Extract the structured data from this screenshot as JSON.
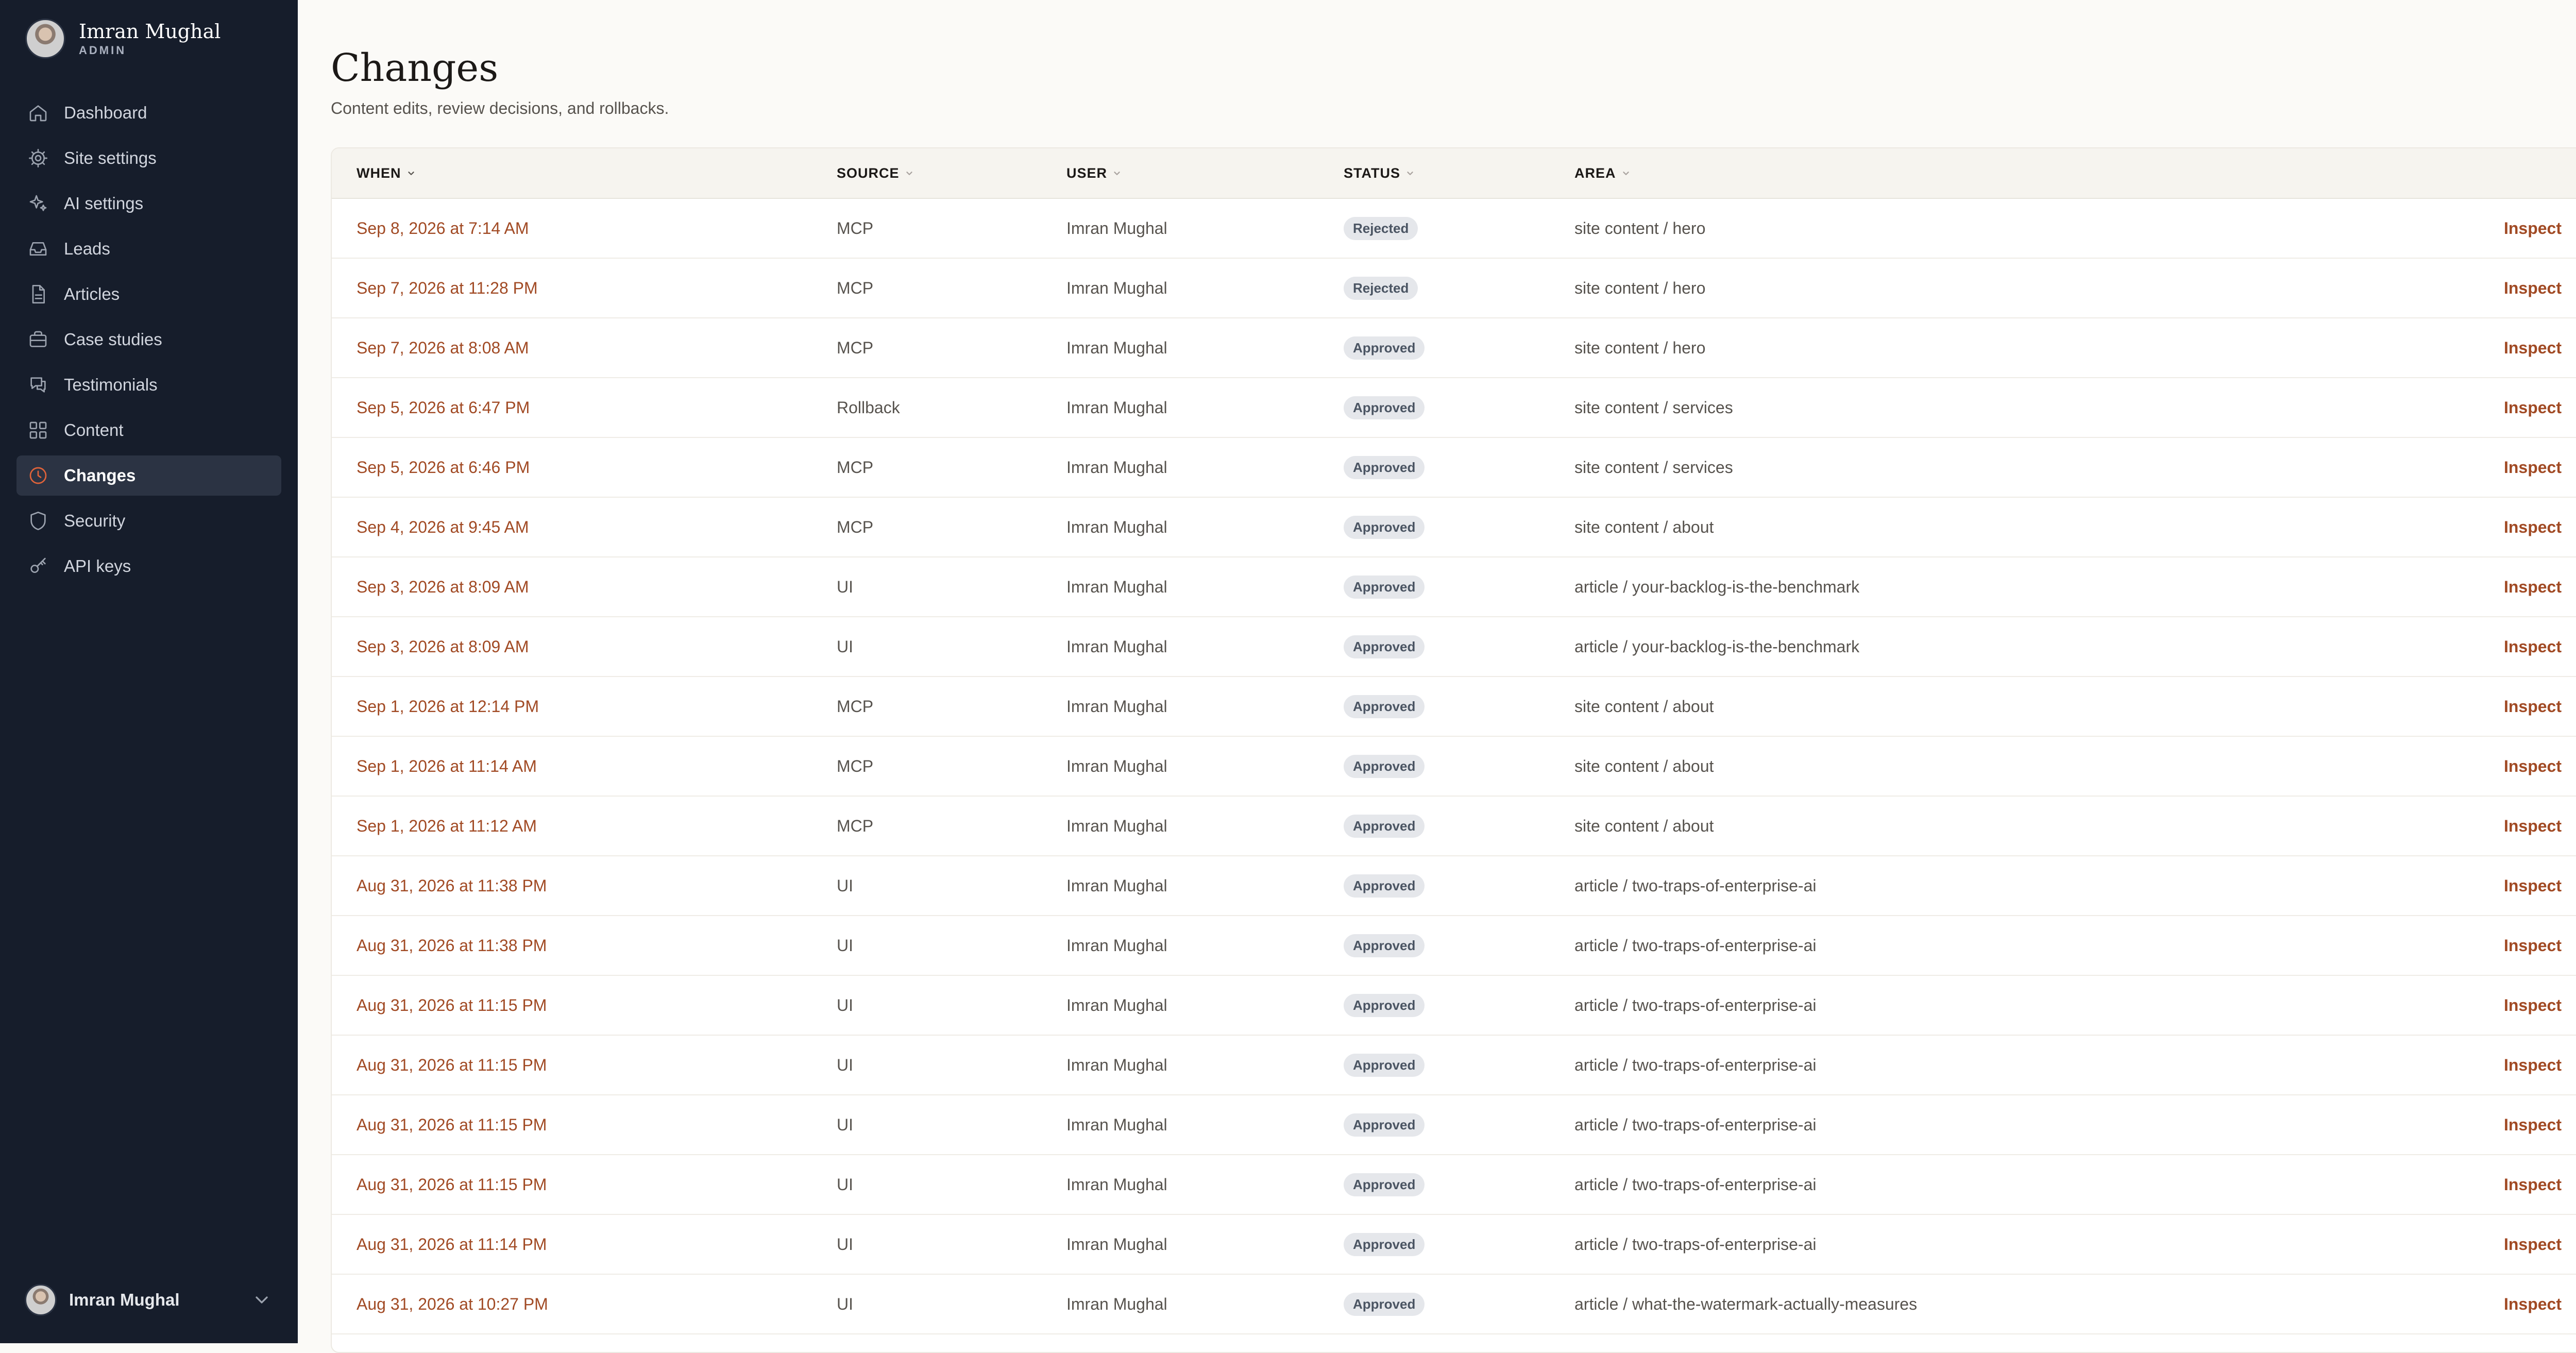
{
  "sidebar": {
    "profile": {
      "name": "Imran Mughal",
      "role": "ADMIN"
    },
    "items": [
      {
        "label": "Dashboard",
        "icon": "home-icon"
      },
      {
        "label": "Site settings",
        "icon": "gear-icon"
      },
      {
        "label": "AI settings",
        "icon": "sparkles-icon"
      },
      {
        "label": "Leads",
        "icon": "inbox-icon"
      },
      {
        "label": "Articles",
        "icon": "document-icon"
      },
      {
        "label": "Case studies",
        "icon": "briefcase-icon"
      },
      {
        "label": "Testimonials",
        "icon": "chat-icon"
      },
      {
        "label": "Content",
        "icon": "grid-icon"
      },
      {
        "label": "Changes",
        "icon": "clock-icon",
        "active": true
      },
      {
        "label": "Security",
        "icon": "shield-icon"
      },
      {
        "label": "API keys",
        "icon": "key-icon"
      }
    ],
    "footer_user": {
      "name": "Imran Mughal"
    }
  },
  "page": {
    "title": "Changes",
    "subtitle": "Content edits, review decisions, and rollbacks."
  },
  "table": {
    "columns": {
      "when": "WHEN",
      "source": "SOURCE",
      "user": "USER",
      "status": "STATUS",
      "area": "AREA"
    },
    "action_label": "Inspect",
    "rows": [
      {
        "when": "Sep 8, 2026 at 7:14 AM",
        "source": "MCP",
        "user": "Imran Mughal",
        "status": "Rejected",
        "area": "site content / hero"
      },
      {
        "when": "Sep 7, 2026 at 11:28 PM",
        "source": "MCP",
        "user": "Imran Mughal",
        "status": "Rejected",
        "area": "site content / hero"
      },
      {
        "when": "Sep 7, 2026 at 8:08 AM",
        "source": "MCP",
        "user": "Imran Mughal",
        "status": "Approved",
        "area": "site content / hero"
      },
      {
        "when": "Sep 5, 2026 at 6:47 PM",
        "source": "Rollback",
        "user": "Imran Mughal",
        "status": "Approved",
        "area": "site content / services"
      },
      {
        "when": "Sep 5, 2026 at 6:46 PM",
        "source": "MCP",
        "user": "Imran Mughal",
        "status": "Approved",
        "area": "site content / services"
      },
      {
        "when": "Sep 4, 2026 at 9:45 AM",
        "source": "MCP",
        "user": "Imran Mughal",
        "status": "Approved",
        "area": "site content / about"
      },
      {
        "when": "Sep 3, 2026 at 8:09 AM",
        "source": "UI",
        "user": "Imran Mughal",
        "status": "Approved",
        "area": "article / your-backlog-is-the-benchmark"
      },
      {
        "when": "Sep 3, 2026 at 8:09 AM",
        "source": "UI",
        "user": "Imran Mughal",
        "status": "Approved",
        "area": "article / your-backlog-is-the-benchmark"
      },
      {
        "when": "Sep 1, 2026 at 12:14 PM",
        "source": "MCP",
        "user": "Imran Mughal",
        "status": "Approved",
        "area": "site content / about"
      },
      {
        "when": "Sep 1, 2026 at 11:14 AM",
        "source": "MCP",
        "user": "Imran Mughal",
        "status": "Approved",
        "area": "site content / about"
      },
      {
        "when": "Sep 1, 2026 at 11:12 AM",
        "source": "MCP",
        "user": "Imran Mughal",
        "status": "Approved",
        "area": "site content / about"
      },
      {
        "when": "Aug 31, 2026 at 11:38 PM",
        "source": "UI",
        "user": "Imran Mughal",
        "status": "Approved",
        "area": "article / two-traps-of-enterprise-ai"
      },
      {
        "when": "Aug 31, 2026 at 11:38 PM",
        "source": "UI",
        "user": "Imran Mughal",
        "status": "Approved",
        "area": "article / two-traps-of-enterprise-ai"
      },
      {
        "when": "Aug 31, 2026 at 11:15 PM",
        "source": "UI",
        "user": "Imran Mughal",
        "status": "Approved",
        "area": "article / two-traps-of-enterprise-ai"
      },
      {
        "when": "Aug 31, 2026 at 11:15 PM",
        "source": "UI",
        "user": "Imran Mughal",
        "status": "Approved",
        "area": "article / two-traps-of-enterprise-ai"
      },
      {
        "when": "Aug 31, 2026 at 11:15 PM",
        "source": "UI",
        "user": "Imran Mughal",
        "status": "Approved",
        "area": "article / two-traps-of-enterprise-ai"
      },
      {
        "when": "Aug 31, 2026 at 11:15 PM",
        "source": "UI",
        "user": "Imran Mughal",
        "status": "Approved",
        "area": "article / two-traps-of-enterprise-ai"
      },
      {
        "when": "Aug 31, 2026 at 11:14 PM",
        "source": "UI",
        "user": "Imran Mughal",
        "status": "Approved",
        "area": "article / two-traps-of-enterprise-ai"
      },
      {
        "when": "Aug 31, 2026 at 10:27 PM",
        "source": "UI",
        "user": "Imran Mughal",
        "status": "Approved",
        "area": "article / what-the-watermark-actually-measures"
      }
    ]
  },
  "colors": {
    "sidebar_bg": "#161d2b",
    "active_item_bg": "#2b3343",
    "accent": "#a14a24",
    "page_bg": "#fbfaf7",
    "active_icon": "#e0633a"
  }
}
